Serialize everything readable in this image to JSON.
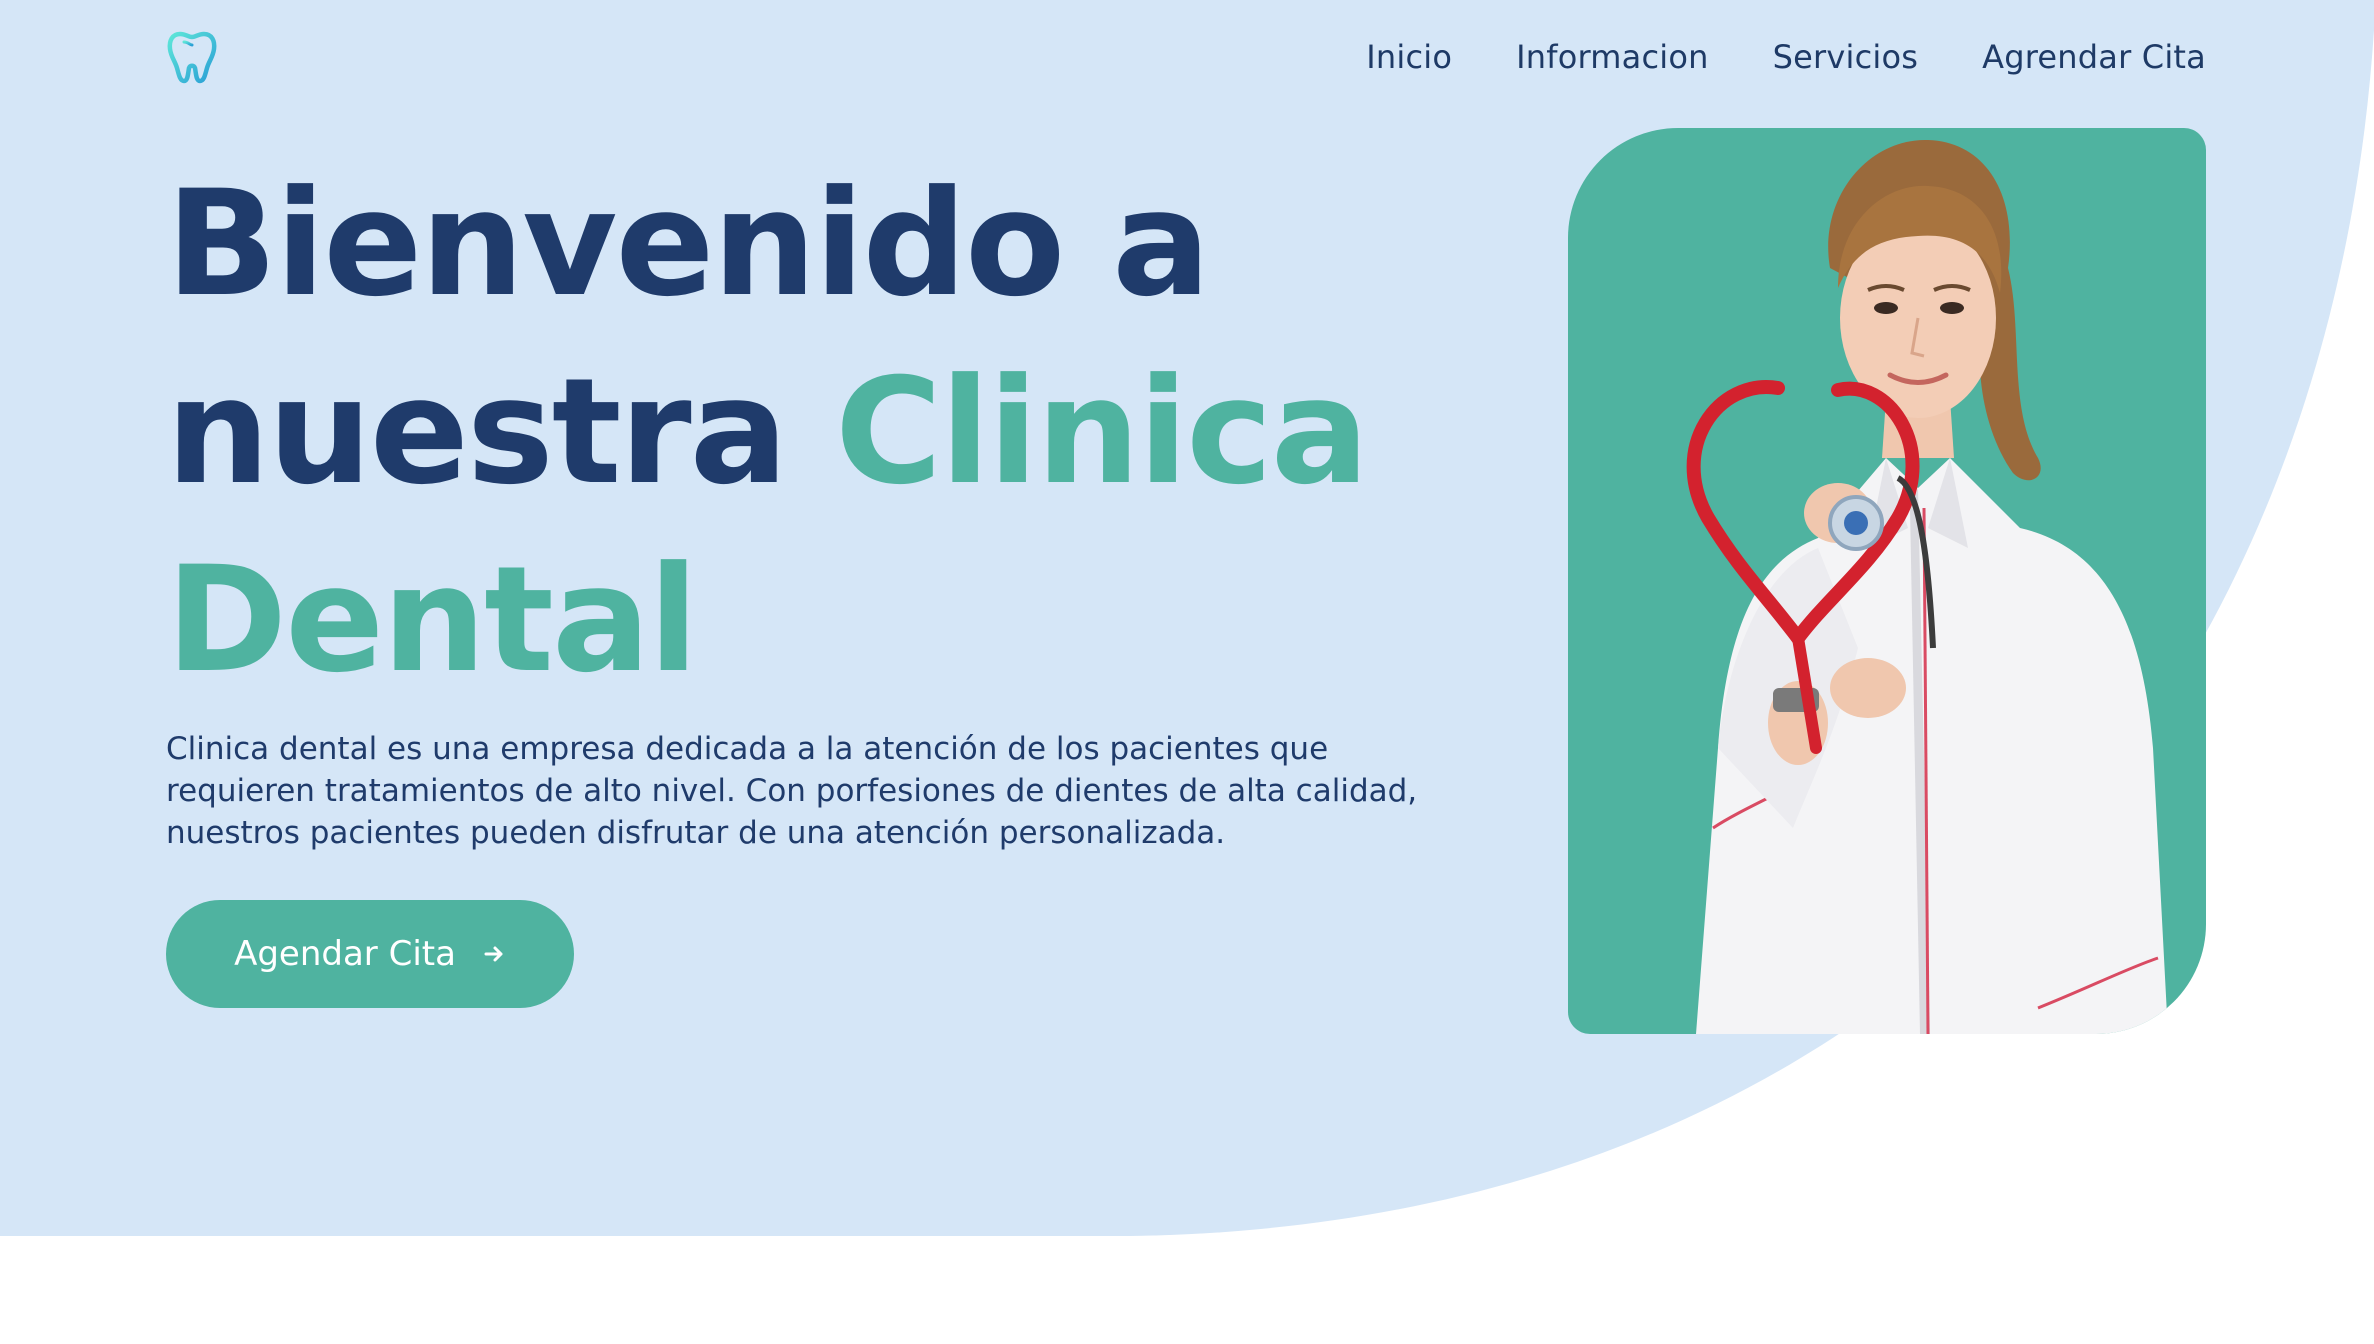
{
  "header": {
    "logo_icon": "tooth-icon",
    "nav": [
      {
        "label": "Inicio"
      },
      {
        "label": "Informacion"
      },
      {
        "label": "Servicios"
      },
      {
        "label": "Agrendar Cita"
      }
    ]
  },
  "hero": {
    "title_line1": "Bienvenido a",
    "title_line2_dark": "nuestra",
    "title_line2_accent": "Clinica",
    "title_line3_accent": "Dental",
    "description": "Clinica dental es una empresa dedicada a la atención de los pacientes que requieren tratamientos de alto nivel. Con porfesiones de dientes de alta calidad, nuestros pacientes pueden disfrutar de una atención personalizada.",
    "cta_label": "Agendar Cita",
    "cta_icon": "arrow-right-icon",
    "image": "doctor-with-stethoscope-photo"
  },
  "colors": {
    "background_blob": "#d5e6f7",
    "primary_dark": "#1f3b6b",
    "accent": "#4fb3a0",
    "page_background": "#ffffff"
  }
}
